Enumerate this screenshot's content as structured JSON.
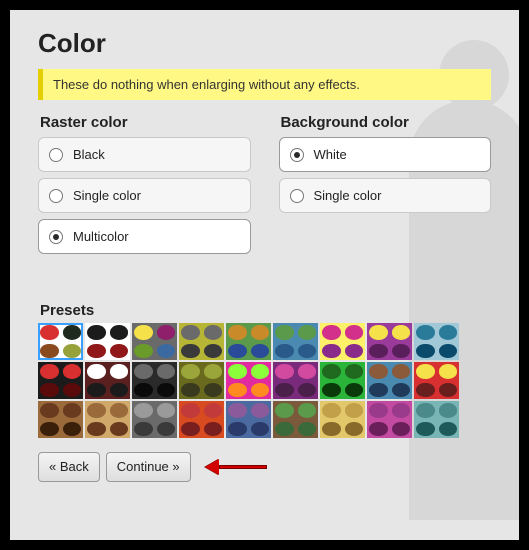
{
  "header": {
    "title": "Color"
  },
  "notice": {
    "text": "These do nothing when enlarging without any effects."
  },
  "raster": {
    "title": "Raster color",
    "options": [
      {
        "label": "Black",
        "selected": false
      },
      {
        "label": "Single color",
        "selected": false
      },
      {
        "label": "Multicolor",
        "selected": true
      }
    ]
  },
  "background": {
    "title": "Background color",
    "options": [
      {
        "label": "White",
        "selected": true
      },
      {
        "label": "Single color",
        "selected": false
      }
    ]
  },
  "presets": {
    "title": "Presets",
    "rows": [
      [
        {
          "selected": true,
          "bg": "#ffffff",
          "dots": [
            "#d83030",
            "#1f2b1f",
            "#8a4a1f",
            "#97a23a"
          ]
        },
        {
          "selected": false,
          "bg": "#ffffff",
          "dots": [
            "#1b1b1b",
            "#1b1b1b",
            "#901818",
            "#901818"
          ]
        },
        {
          "selected": false,
          "bg": "#6a6a6a",
          "dots": [
            "#f5e14a",
            "#8f1f6a",
            "#6a9a2a",
            "#3a6aa0"
          ]
        },
        {
          "selected": false,
          "bg": "#b7b535",
          "dots": [
            "#6a6a6a",
            "#6a6a6a",
            "#3a3a3a",
            "#3a3a3a"
          ]
        },
        {
          "selected": false,
          "bg": "#5a9a4a",
          "dots": [
            "#c98a2a",
            "#c98a2a",
            "#2a4a9a",
            "#2a4a9a"
          ]
        },
        {
          "selected": false,
          "bg": "#4a8ab0",
          "dots": [
            "#5a9a4a",
            "#5a9a4a",
            "#2a5a8a",
            "#2a5a8a"
          ]
        },
        {
          "selected": false,
          "bg": "#fff06a",
          "dots": [
            "#d2308a",
            "#d2308a",
            "#8a2a8a",
            "#8a2a8a"
          ]
        },
        {
          "selected": false,
          "bg": "#9a3a9a",
          "dots": [
            "#f5e14a",
            "#f5e14a",
            "#5a1f5a",
            "#5a1f5a"
          ]
        },
        {
          "selected": false,
          "bg": "#a0c8d6",
          "dots": [
            "#2a7a9a",
            "#2a7a9a",
            "#0a4a6a",
            "#0a4a6a"
          ]
        }
      ],
      [
        {
          "selected": false,
          "bg": "#1b1b1b",
          "dots": [
            "#d83030",
            "#d83030",
            "#5a0a0a",
            "#5a0a0a"
          ]
        },
        {
          "selected": false,
          "bg": "#5a1f1f",
          "dots": [
            "#ffffff",
            "#ffffff",
            "#1b1b1b",
            "#1b1b1b"
          ]
        },
        {
          "selected": false,
          "bg": "#2a2a2a",
          "dots": [
            "#6a6a6a",
            "#6a6a6a",
            "#0a0a0a",
            "#0a0a0a"
          ]
        },
        {
          "selected": false,
          "bg": "#6a6a1f",
          "dots": [
            "#9aa53a",
            "#9aa53a",
            "#3a3a1f",
            "#3a3a1f"
          ]
        },
        {
          "selected": false,
          "bg": "#e22aa0",
          "dots": [
            "#8aff3a",
            "#8aff3a",
            "#ff8a1f",
            "#ff8a1f"
          ]
        },
        {
          "selected": false,
          "bg": "#7a2a7a",
          "dots": [
            "#d24aa0",
            "#d24aa0",
            "#4a1f4a",
            "#4a1f4a"
          ]
        },
        {
          "selected": false,
          "bg": "#2ab53a",
          "dots": [
            "#1f6a1f",
            "#1f6a1f",
            "#0a3a0a",
            "#0a3a0a"
          ]
        },
        {
          "selected": false,
          "bg": "#4a8ab0",
          "dots": [
            "#8a5a3a",
            "#8a5a3a",
            "#1f3a5a",
            "#1f3a5a"
          ]
        },
        {
          "selected": false,
          "bg": "#d83030",
          "dots": [
            "#f5e14a",
            "#f5e14a",
            "#6a1f1f",
            "#6a1f1f"
          ]
        }
      ],
      [
        {
          "selected": false,
          "bg": "#9a6a3a",
          "dots": [
            "#6a3a1f",
            "#6a3a1f",
            "#3a1f0a",
            "#3a1f0a"
          ]
        },
        {
          "selected": false,
          "bg": "#cfa86a",
          "dots": [
            "#9a6a3a",
            "#9a6a3a",
            "#6a3a1f",
            "#6a3a1f"
          ]
        },
        {
          "selected": false,
          "bg": "#6a6a6a",
          "dots": [
            "#9a9a9a",
            "#9a9a9a",
            "#3a3a3a",
            "#3a3a3a"
          ]
        },
        {
          "selected": false,
          "bg": "#d84a1f",
          "dots": [
            "#c23a3a",
            "#c23a3a",
            "#7a1f1f",
            "#7a1f1f"
          ]
        },
        {
          "selected": false,
          "bg": "#4a6aa0",
          "dots": [
            "#8a5a9a",
            "#8a5a9a",
            "#2a3a6a",
            "#2a3a6a"
          ]
        },
        {
          "selected": false,
          "bg": "#7a5a3a",
          "dots": [
            "#5a9a4a",
            "#5a9a4a",
            "#3a6a3a",
            "#3a6a3a"
          ]
        },
        {
          "selected": false,
          "bg": "#e2c86a",
          "dots": [
            "#c2a04a",
            "#c2a04a",
            "#8a6a2a",
            "#8a6a2a"
          ]
        },
        {
          "selected": false,
          "bg": "#c24aa0",
          "dots": [
            "#9a3a8a",
            "#9a3a8a",
            "#6a1f5a",
            "#6a1f5a"
          ]
        },
        {
          "selected": false,
          "bg": "#7ab5b5",
          "dots": [
            "#4a8a8a",
            "#4a8a8a",
            "#1f5a5a",
            "#1f5a5a"
          ]
        }
      ]
    ]
  },
  "buttons": {
    "back": "« Back",
    "continue": "Continue »"
  }
}
